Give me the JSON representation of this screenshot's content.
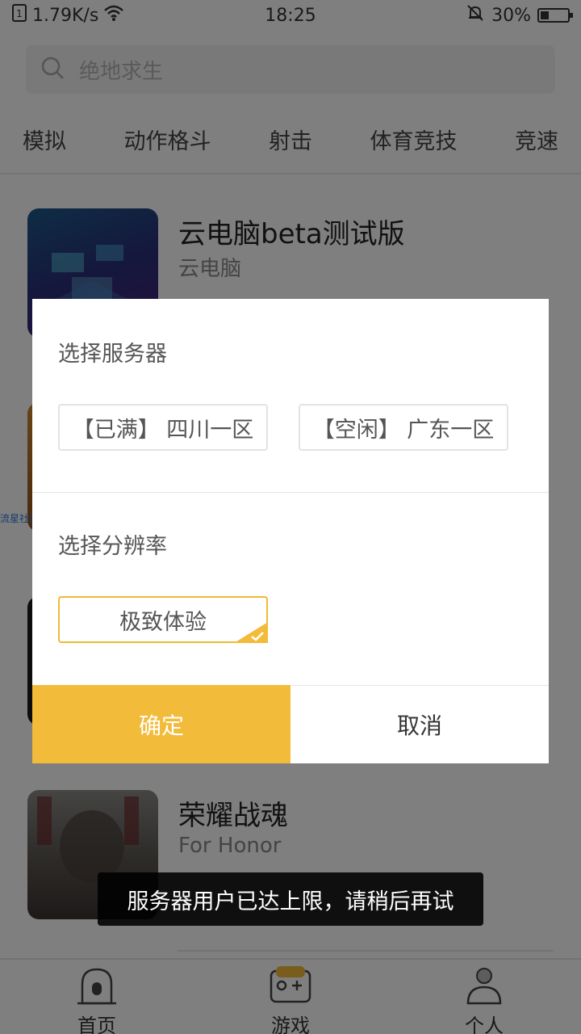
{
  "status_bar": {
    "network_speed": "1.79K/s",
    "time": "18:25",
    "battery_text": "30%",
    "battery_level": 0.3
  },
  "search": {
    "placeholder": "绝地求生"
  },
  "categories": [
    "模拟",
    "动作格斗",
    "射击",
    "体育竞技",
    "竞速"
  ],
  "apps": [
    {
      "name": "云电脑beta测试版",
      "subtitle": "云电脑"
    },
    {
      "name": "荣耀战魂",
      "subtitle": "For Honor"
    }
  ],
  "side_link": "流星社区",
  "dialog": {
    "server_title": "选择服务器",
    "servers": [
      "【已满】 四川一区",
      "【空闲】 广东一区"
    ],
    "resolution_title": "选择分辨率",
    "resolution_option": "极致体验",
    "confirm_label": "确定",
    "cancel_label": "取消",
    "accent_color": "#f2bb3a"
  },
  "toast": "服务器用户已达上限，请稍后再试",
  "tabs": [
    {
      "label": "首页"
    },
    {
      "label": "游戏"
    },
    {
      "label": "个人"
    }
  ]
}
